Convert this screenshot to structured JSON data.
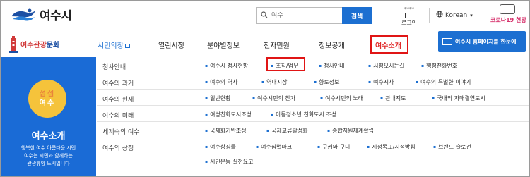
{
  "header": {
    "logo_text": "여수시",
    "search": {
      "placeholder": "여수",
      "button": "검색"
    },
    "login": {
      "stars": "****",
      "label": "로그인"
    },
    "language": "Korean",
    "covid": "코로나19 현황"
  },
  "nav": {
    "tour_logo": {
      "part1": "여수관광",
      "part2": "문화"
    },
    "items": [
      {
        "label": "시민의창"
      },
      {
        "label": "열린시정"
      },
      {
        "label": "분야별정보"
      },
      {
        "label": "전자민원"
      },
      {
        "label": "정보공개"
      },
      {
        "label": "여수소개"
      }
    ],
    "promo": "여수시 홈페이지를 한눈에"
  },
  "panel": {
    "badge_line1": "섬섬",
    "badge_line2": "여수",
    "title": "여수소개",
    "desc1": "행복한 여수 아름다운 시민",
    "desc2": "여수는 시민과 함께하는",
    "desc3": "관광휴양 도시입니다"
  },
  "menu": [
    {
      "category": "청사안내",
      "links": [
        "여수시 청사현황",
        "조직/업무",
        "청사안내",
        "시청오시는길",
        "행정전화번호"
      ]
    },
    {
      "category": "여수의 과거",
      "links": [
        "여수의 역사",
        "역대시장",
        "향토정보",
        "여수시사",
        "여수의 특별한 이야기"
      ]
    },
    {
      "category": "여수의 현재",
      "links": [
        "일반현황",
        "여수시민의 찬가",
        "여수시민의 노래",
        "관내지도",
        "국내외 자매결연도시"
      ]
    },
    {
      "category": "여수의 미래",
      "links": [
        "여성친화도시조성",
        "아동청소년 친화도시 조성"
      ]
    },
    {
      "category": "세계속의 여수",
      "links": [
        "국제화기반조성",
        "국제교류활성화",
        "종합지원체계확립"
      ]
    },
    {
      "category": "여수의 상징",
      "links": [
        "여수상징물",
        "여수심벌마크",
        "구커와 구니",
        "시정목표/시정방침",
        "브랜드 슬로건",
        "시민운동 실천요고"
      ]
    }
  ],
  "colors": {
    "accent": "#1c6fd1",
    "highlight": "#e01515",
    "panel": "#1a6bd6",
    "badge": "#f5c33b"
  }
}
